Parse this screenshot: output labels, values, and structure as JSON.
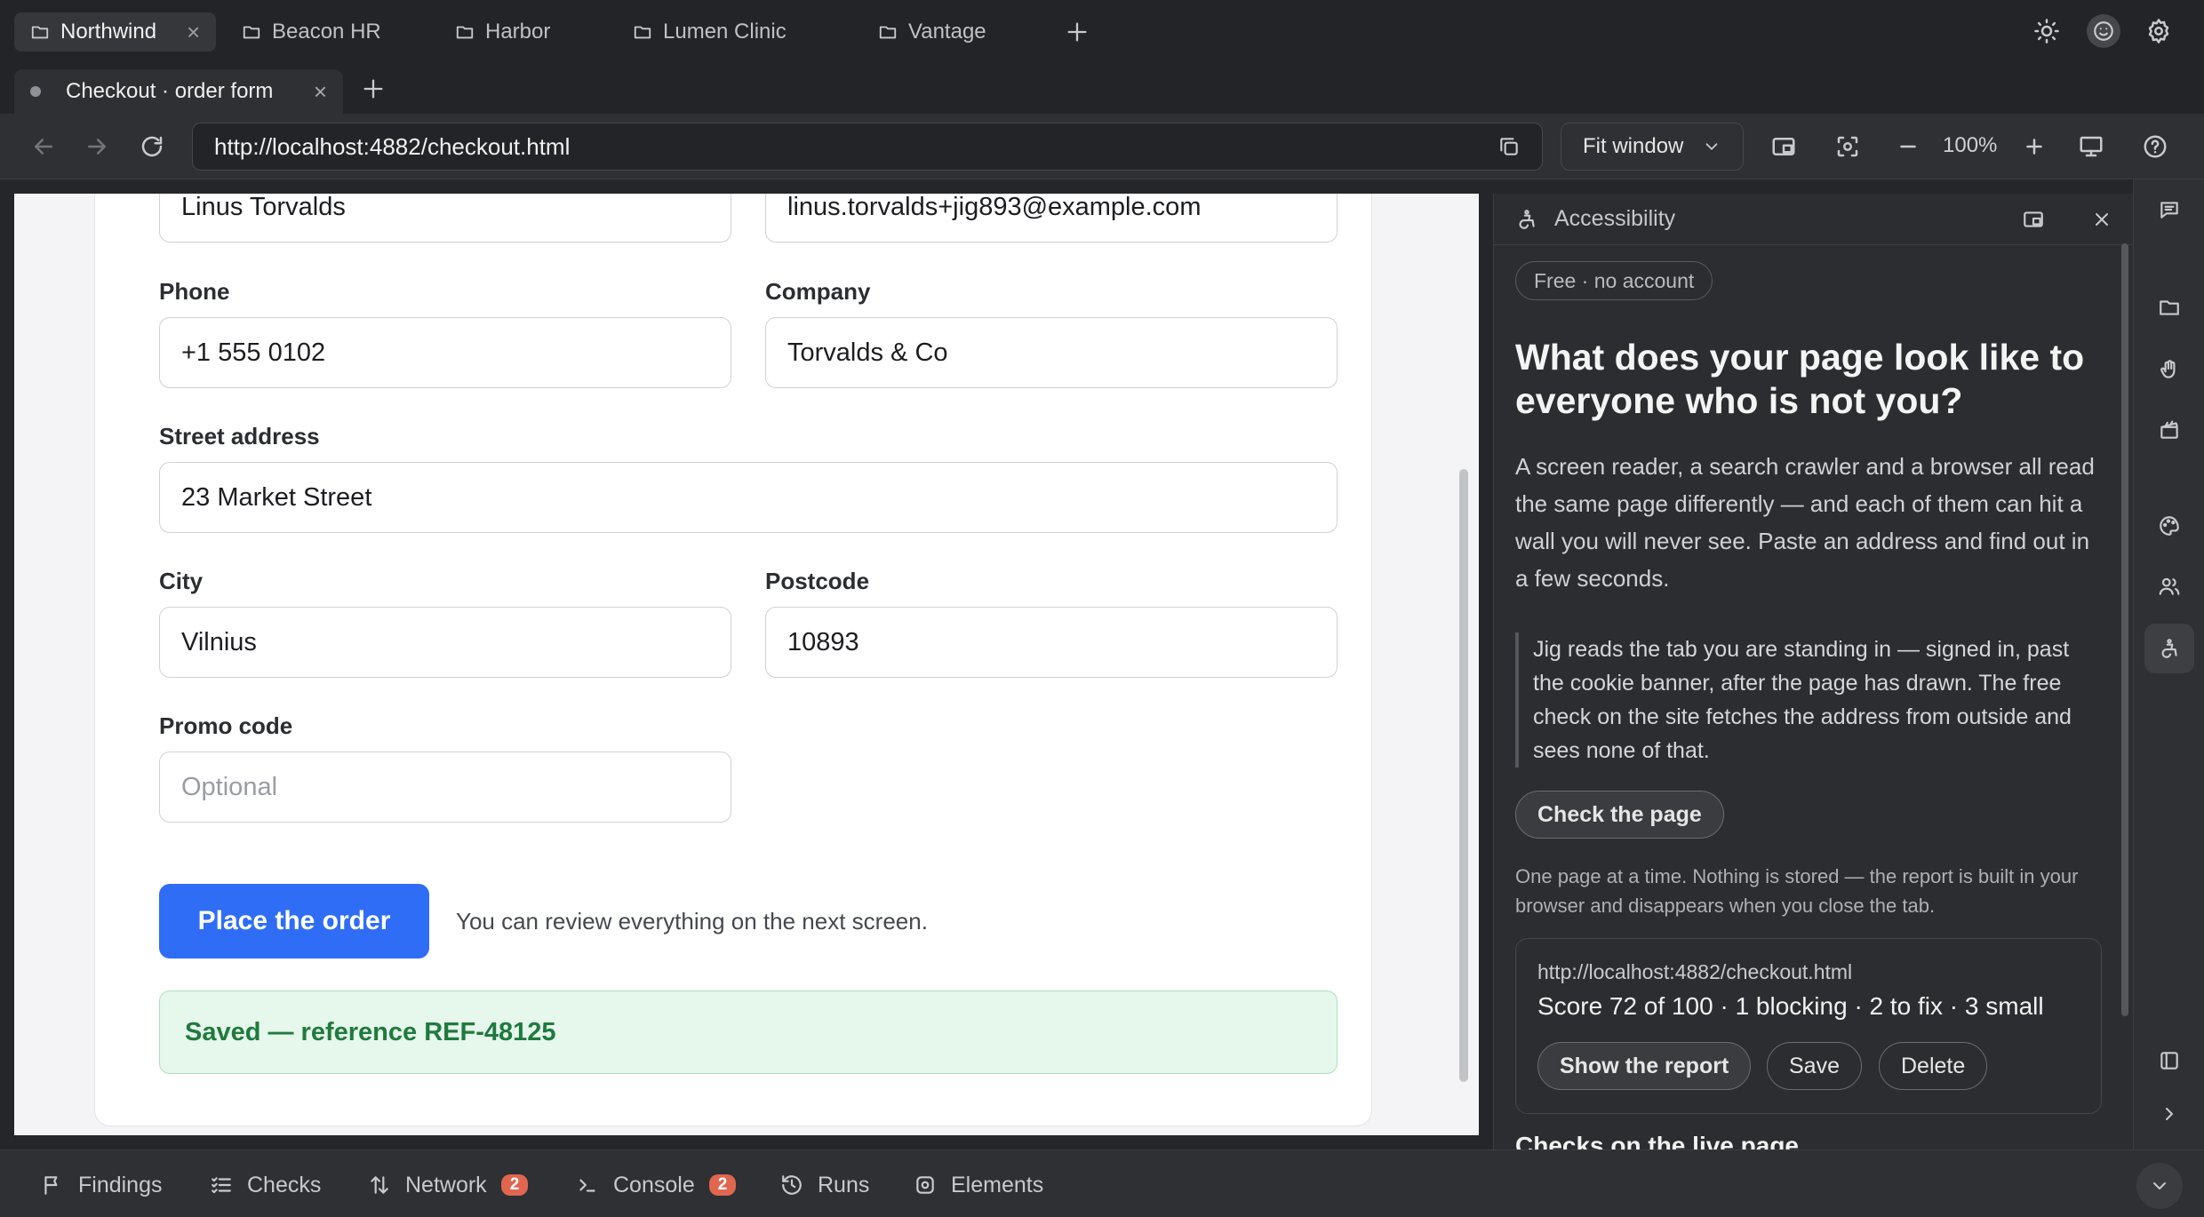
{
  "workspaces": [
    "Northwind",
    "Beacon HR",
    "Harbor",
    "Lumen Clinic",
    "Vantage"
  ],
  "page_tab": {
    "title": "Checkout · order form"
  },
  "toolbar": {
    "url": "http://localhost:4882/checkout.html",
    "fit_label": "Fit window",
    "zoom": "100%"
  },
  "form": {
    "name_value": "Linus Torvalds",
    "email_value": "linus.torvalds+jig893@example.com",
    "phone_label": "Phone",
    "phone_value": "+1 555 0102",
    "company_label": "Company",
    "company_value": "Torvalds & Co",
    "street_label": "Street address",
    "street_value": "23 Market Street",
    "city_label": "City",
    "city_value": "Vilnius",
    "postcode_label": "Postcode",
    "postcode_value": "10893",
    "promo_label": "Promo code",
    "promo_placeholder": "Optional",
    "submit_label": "Place the order",
    "submit_hint": "You can review everything on the next screen.",
    "saved_message": "Saved — reference REF-48125"
  },
  "panel": {
    "title": "Accessibility",
    "pill": "Free · no account",
    "headline": "What does your page look like to everyone who is not you?",
    "intro": "A screen reader, a search crawler and a browser all read the same page differently — and each of them can hit a wall you will never see. Paste an address and find out in a few seconds.",
    "quote": "Jig reads the tab you are standing in — signed in, past the cookie banner, after the page has drawn. The free check on the site fetches the address from outside and sees none of that.",
    "check_button": "Check the page",
    "note": "One page at a time. Nothing is stored — the report is built in your browser and disappears when you close the tab.",
    "report": {
      "url": "http://localhost:4882/checkout.html",
      "score_line": "Score 72 of 100 · 1 blocking · 2 to fix · 3 small",
      "show_label": "Show the report",
      "save_label": "Save",
      "delete_label": "Delete"
    },
    "section_heading": "Checks on the live page"
  },
  "bottom_tabs": [
    {
      "label": "Findings",
      "icon": "flag-icon"
    },
    {
      "label": "Checks",
      "icon": "checklist-icon"
    },
    {
      "label": "Network",
      "icon": "arrows-icon",
      "badge": "2"
    },
    {
      "label": "Console",
      "icon": "terminal-icon",
      "badge": "2"
    },
    {
      "label": "Runs",
      "icon": "history-icon"
    },
    {
      "label": "Elements",
      "icon": "target-icon"
    }
  ]
}
